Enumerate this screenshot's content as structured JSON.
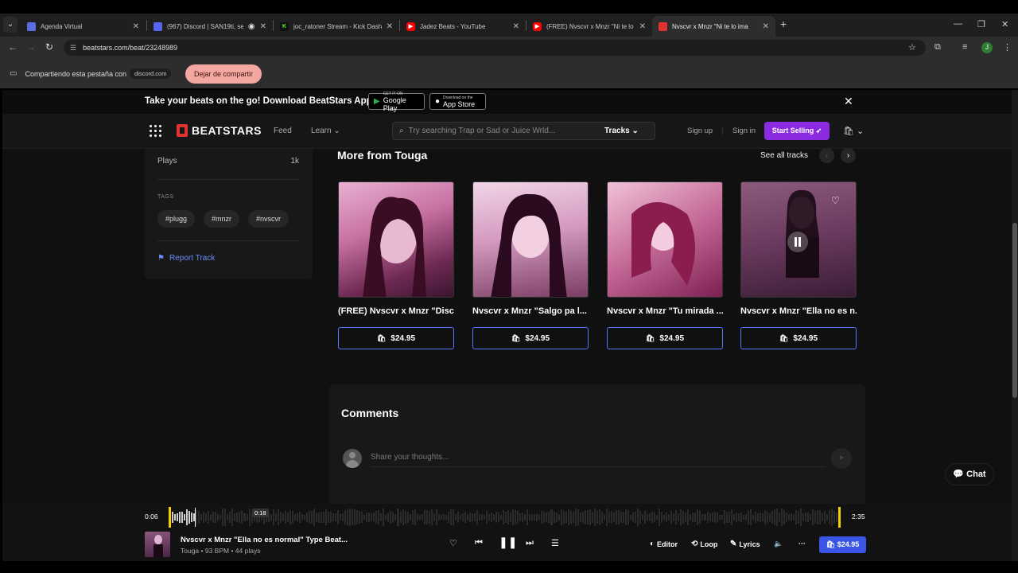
{
  "browser": {
    "tabs": [
      {
        "title": "Agenda Virtual",
        "icon": "agenda-icon",
        "color": "#5b6ee1"
      },
      {
        "title": "(967) Discord | SAN19ti, sel",
        "icon": "discord-icon",
        "color": "#5865f2"
      },
      {
        "title": "joc_ratoner Stream - Kick Dashb",
        "icon": "kick-icon",
        "color": "#53fc18"
      },
      {
        "title": "Jadez Beats - YouTube",
        "icon": "youtube-icon",
        "color": "#ff0000"
      },
      {
        "title": "(FREE) Nvscvr x Mnzr \"Ni te lo i",
        "icon": "youtube-icon",
        "color": "#ff0000"
      },
      {
        "title": "Nvscvr x Mnzr \"Ni te lo ima",
        "icon": "beatstars-icon",
        "color": "#e0322e"
      }
    ],
    "url": "beatstars.com/beat/23248989",
    "share_text": "Compartiendo esta pestaña con",
    "share_target": "discord.com",
    "stop_share_label": "Dejar de compartir",
    "profile_initial": "J"
  },
  "promo": {
    "text": "Take your beats on the go! Download BeatStars App",
    "google_small": "GET IT ON",
    "google_big": "Google Play",
    "apple_small": "Download on the",
    "apple_big": "App Store"
  },
  "nav": {
    "logo": "BEATSTARS",
    "feed": "Feed",
    "learn": "Learn",
    "search_placeholder": "Try searching Trap or Sad or Juice Wrld...",
    "search_scope": "Tracks",
    "signup": "Sign up",
    "signin": "Sign in",
    "start_selling": "Start Selling"
  },
  "sidebar": {
    "plays_label": "Plays",
    "plays_value": "1k",
    "tags_label": "TAGS",
    "tags": [
      "#plugg",
      "#mnzr",
      "#nvscvr"
    ],
    "report": "Report Track"
  },
  "more": {
    "title": "More from Touga",
    "see_all": "See all tracks",
    "cards": [
      {
        "title": "(FREE) Nvscvr x Mnzr \"Disc...",
        "price": "$24.95"
      },
      {
        "title": "Nvscvr x Mnzr \"Salgo pa l...",
        "price": "$24.95"
      },
      {
        "title": "Nvscvr x Mnzr \"Tu mirada ...",
        "price": "$24.95"
      },
      {
        "title": "Nvscvr x Mnzr \"Ella no es n...",
        "price": "$24.95"
      }
    ]
  },
  "comments": {
    "title": "Comments",
    "placeholder": "Share your thoughts..."
  },
  "chat": {
    "label": "Chat"
  },
  "player": {
    "elapsed": "0:06",
    "hover_time": "0:18",
    "duration": "2:35",
    "title": "Nvscvr x Mnzr \"Ella no es normal\" Type Beat...",
    "subtitle": "Touga • 93 BPM • 44 plays",
    "editor": "Editor",
    "loop": "Loop",
    "lyrics": "Lyrics",
    "price": "$24.95",
    "progress_fraction": 0.04
  },
  "colors": {
    "accent": "#8a2be2",
    "link": "#6b8dff",
    "buy": "#3b55e6",
    "wave_marker": "#f4d000"
  }
}
